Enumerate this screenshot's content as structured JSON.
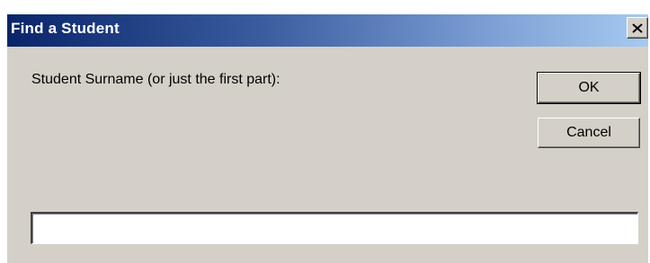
{
  "window": {
    "title": "Find a Student",
    "close_icon": "close-icon"
  },
  "prompt": {
    "label": "Student Surname (or just the first part):"
  },
  "buttons": {
    "ok_label": "OK",
    "cancel_label": "Cancel"
  },
  "input": {
    "value": "",
    "placeholder": ""
  },
  "colors": {
    "dialog_background": "#d4d0c8",
    "titlebar_start": "#0a246a",
    "titlebar_end": "#a6caf0",
    "title_text": "#ffffff"
  }
}
